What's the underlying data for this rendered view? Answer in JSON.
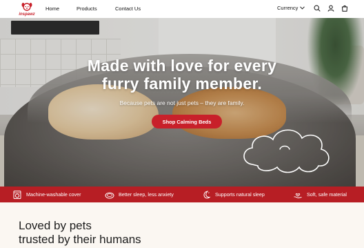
{
  "brand": {
    "name": "inspawz",
    "accent": "#c8202a"
  },
  "nav": {
    "home": "Home",
    "products": "Products",
    "contact": "Contact Us"
  },
  "header": {
    "currency": "Currency",
    "icons": [
      "search-icon",
      "user-icon",
      "cart-icon"
    ]
  },
  "hero": {
    "title_line1": "Made with love for every",
    "title_line2": "furry family member.",
    "subtitle": "Because pets are not just pets – they are family.",
    "cta": "Shop Calming Beds"
  },
  "features": [
    {
      "icon": "washing-machine-icon",
      "label": "Machine-washable cover"
    },
    {
      "icon": "pet-bed-icon",
      "label": "Better sleep, less anxiety"
    },
    {
      "icon": "moon-sleep-icon",
      "label": "Supports natural sleep"
    },
    {
      "icon": "hand-heart-icon",
      "label": "Soft, safe material"
    }
  ],
  "section": {
    "title_line1": "Loved by pets",
    "title_line2": "trusted by their humans"
  },
  "colors": {
    "strip": "#b71e24",
    "button": "#c8202a",
    "section_bg": "#fbf7f2"
  }
}
